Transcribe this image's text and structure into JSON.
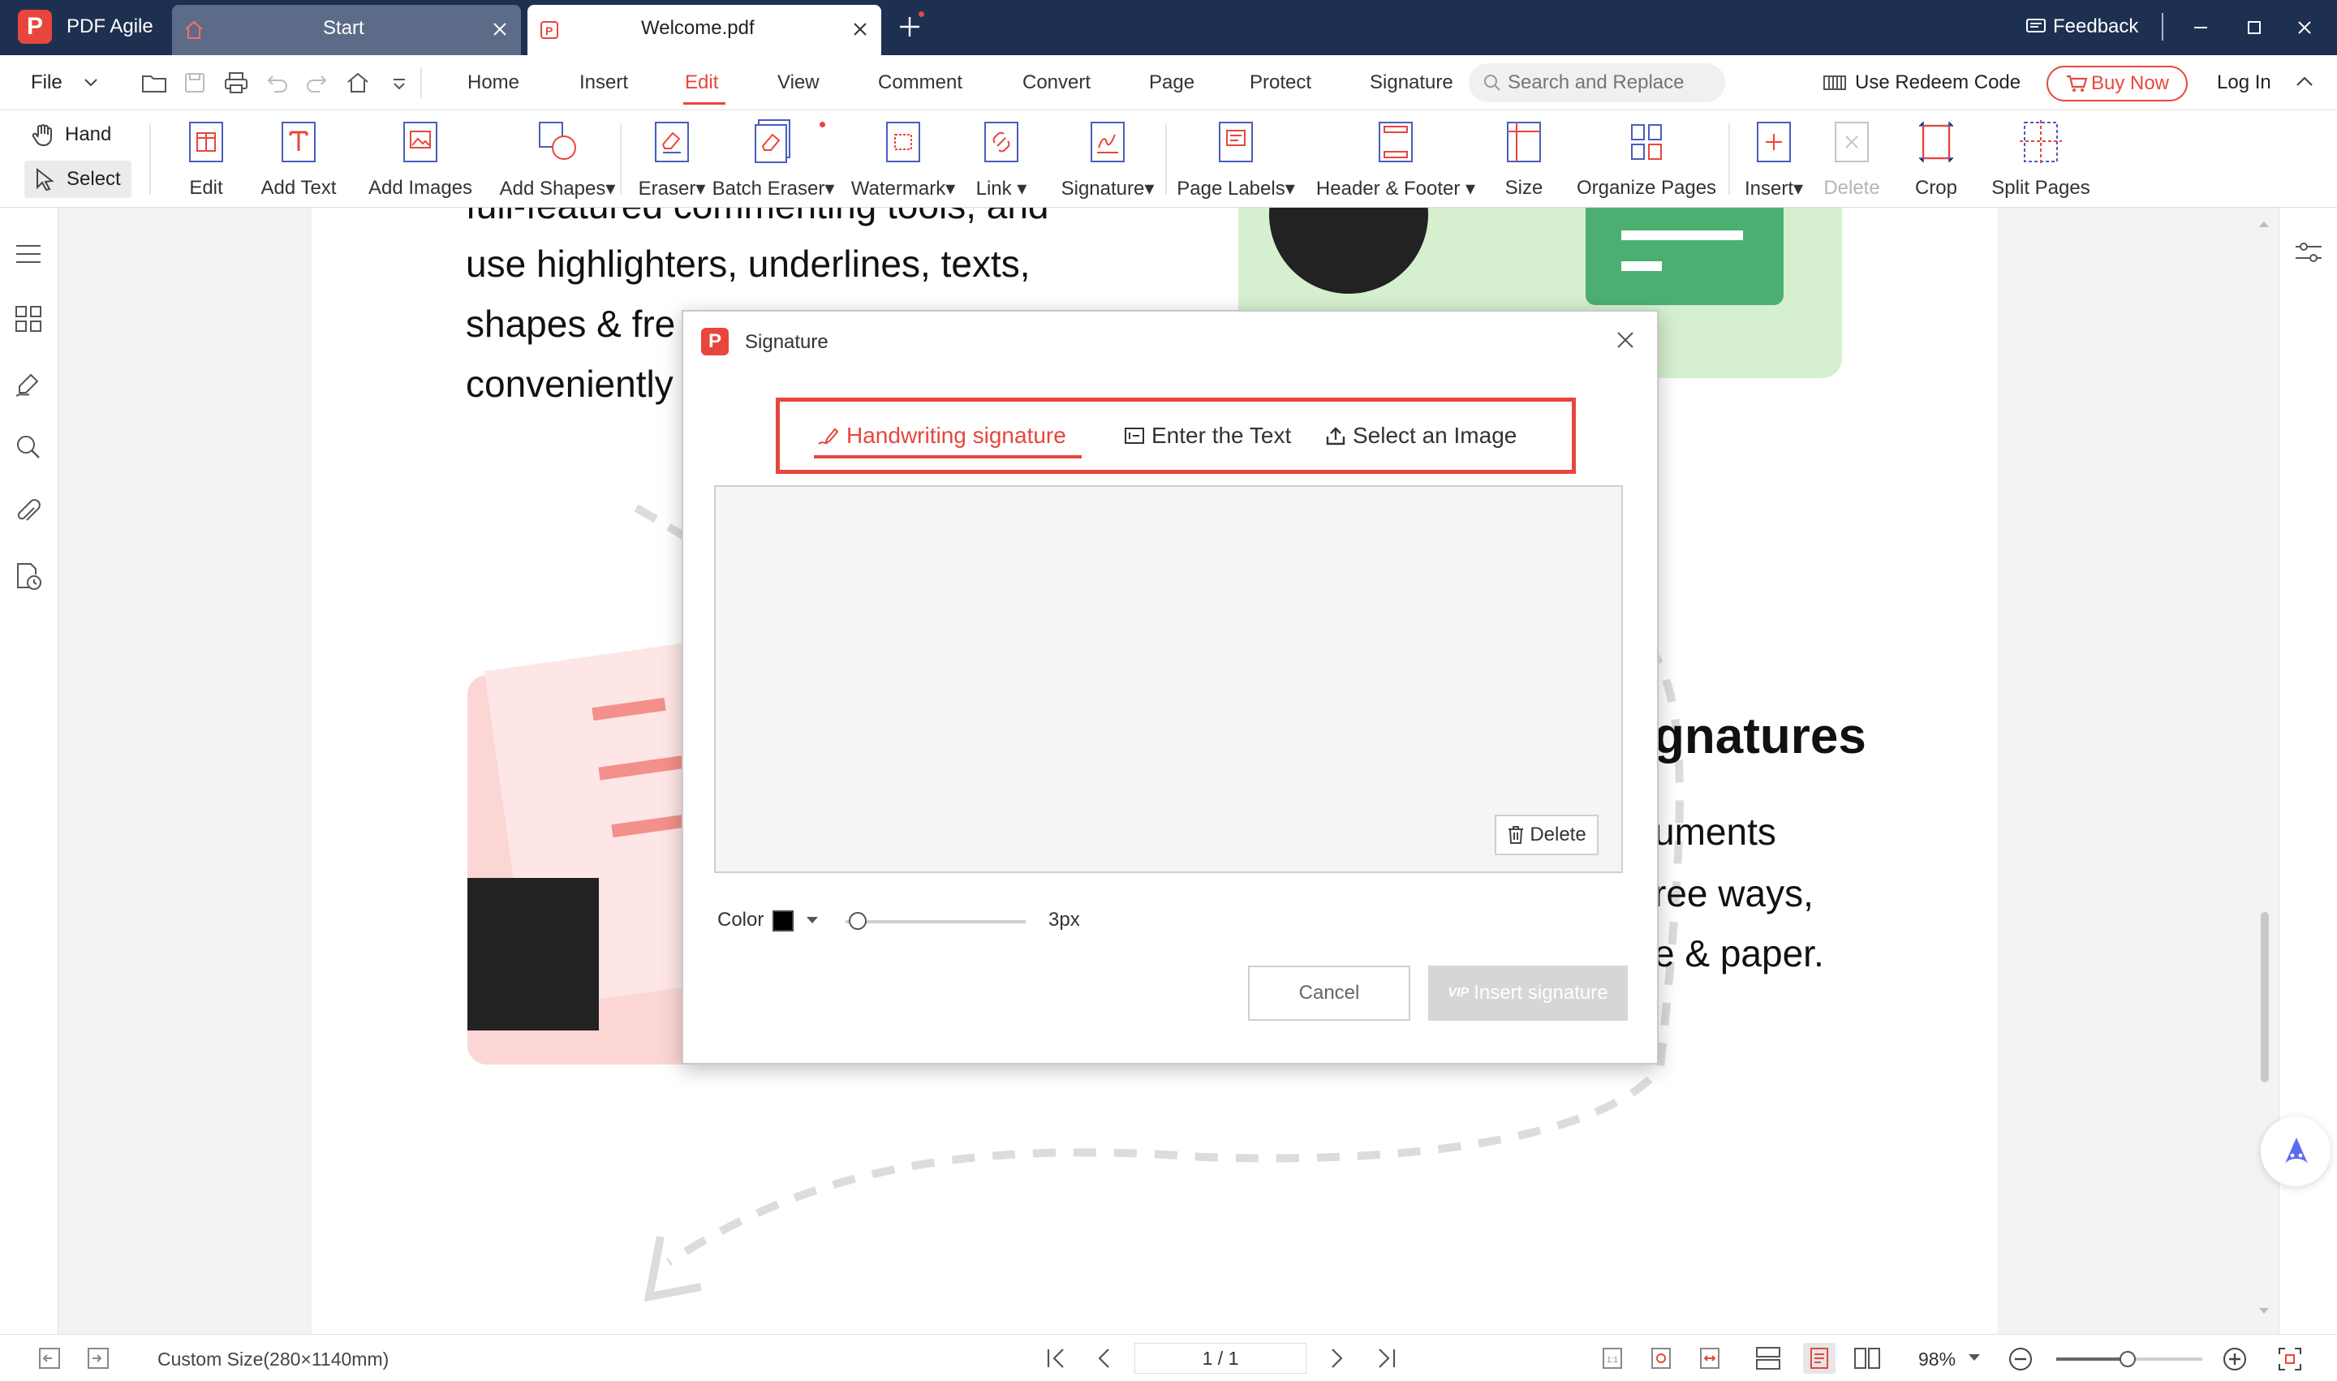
{
  "app": {
    "name": "PDF Agile",
    "logo_letter": "P"
  },
  "tabs": [
    {
      "label": "Start"
    },
    {
      "label": "Welcome.pdf"
    }
  ],
  "titlebar": {
    "feedback": "Feedback"
  },
  "menu": {
    "file": "File",
    "items": [
      "Home",
      "Insert",
      "Edit",
      "View",
      "Comment",
      "Convert",
      "Page",
      "Protect",
      "Signature"
    ],
    "active": "Edit",
    "search_placeholder": "Search and Replace",
    "redeem": "Use Redeem Code",
    "buy_now": "Buy Now",
    "login": "Log In"
  },
  "ribbon": {
    "hand": "Hand",
    "select": "Select",
    "buttons": [
      {
        "label": "Edit",
        "icon": "edit-icon"
      },
      {
        "label": "Add Text",
        "icon": "add-text-icon"
      },
      {
        "label": "Add Images",
        "icon": "add-images-icon"
      },
      {
        "label": "Add Shapes▾",
        "icon": "add-shapes-icon"
      },
      {
        "label": "Eraser▾",
        "icon": "eraser-icon"
      },
      {
        "label": "Batch Eraser▾",
        "icon": "batch-eraser-icon"
      },
      {
        "label": "Watermark▾",
        "icon": "watermark-icon"
      },
      {
        "label": "Link ▾",
        "icon": "link-icon"
      },
      {
        "label": "Signature▾",
        "icon": "signature-icon"
      },
      {
        "label": "Page Labels▾",
        "icon": "page-labels-icon"
      },
      {
        "label": "Header & Footer ▾",
        "icon": "header-footer-icon"
      },
      {
        "label": "Size",
        "icon": "size-icon"
      },
      {
        "label": "Organize Pages",
        "icon": "organize-pages-icon"
      },
      {
        "label": "Insert▾",
        "icon": "insert-page-icon"
      },
      {
        "label": "Delete",
        "icon": "delete-page-icon",
        "disabled": true
      },
      {
        "label": "Crop",
        "icon": "crop-icon"
      },
      {
        "label": "Split Pages",
        "icon": "split-pages-icon"
      }
    ]
  },
  "document": {
    "lines_left": [
      "full-featured commenting tools, and",
      "use highlighters, underlines, texts,",
      "shapes & fre",
      "conveniently"
    ],
    "heading_right": "gnatures",
    "lines_right": [
      "uments",
      "ree ways,",
      "e & paper."
    ]
  },
  "dialog": {
    "title": "Signature",
    "tabs": [
      "Handwriting signature",
      "Enter the Text",
      "Select an Image"
    ],
    "active_tab": "Handwriting signature",
    "delete": "Delete",
    "color_label": "Color",
    "color_value": "#000000",
    "thickness": "3px",
    "thickness_fraction": 0.05,
    "cancel": "Cancel",
    "vip": "VIP",
    "insert": "Insert signature"
  },
  "status": {
    "page_size": "Custom Size(280×1140mm)",
    "page_indicator": "1 / 1",
    "zoom": "98%",
    "zoom_fraction": 0.49
  },
  "colors": {
    "accent": "#e8463d",
    "titlebar": "#1e3051",
    "green": "#4caf72"
  }
}
